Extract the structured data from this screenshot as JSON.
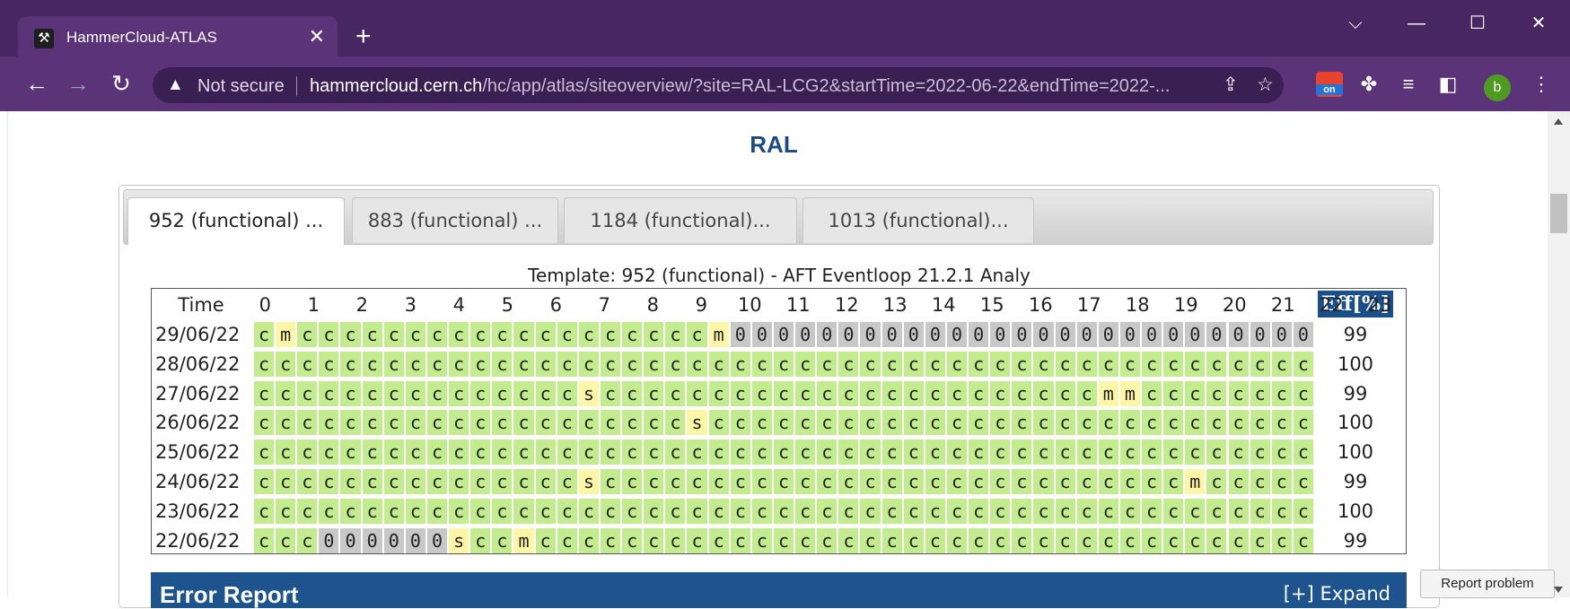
{
  "browser": {
    "tab_title": "HammerCloud-ATLAS",
    "tab_icon": "hammer-icon",
    "not_secure": "Not secure",
    "url_host": "hammercloud.cern.ch",
    "url_path": "/hc/app/atlas/siteoverview/?site=RAL-LCG2&startTime=2022-06-22&endTime=2022-...",
    "profile_initial": "b",
    "extension_badge": "on",
    "colors": {
      "frame": "#472662",
      "toolbar": "#5b3378",
      "omnibox": "#3a1f52",
      "avatar": "#4f9b22"
    }
  },
  "page": {
    "site_title": "RAL",
    "tabs": [
      {
        "label": "952 (functional) ...",
        "active": true
      },
      {
        "label": "883 (functional) ...",
        "active": false
      },
      {
        "label": "1184 (functional)...",
        "active": false
      },
      {
        "label": "1013 (functional)...",
        "active": false
      }
    ],
    "template_title": "Template: 952 (functional) - AFT Eventloop 21.2.1 Analy",
    "grid": {
      "time_label": "Time",
      "eff_label": "Eff[%]",
      "hours": [
        "0",
        "1",
        "2",
        "3",
        "4",
        "5",
        "6",
        "7",
        "8",
        "9",
        "10",
        "11",
        "12",
        "13",
        "14",
        "15",
        "16",
        "17",
        "18",
        "19",
        "20",
        "21",
        "22",
        "23"
      ],
      "legend_colors": {
        "c": "#c2ec8e",
        "m": "#fdf6a6",
        "s": "#fdf6a6",
        "0": "#c8c8c8"
      },
      "rows": [
        {
          "date": "29/06/22",
          "cells": "cmcccccccccccccccccccm000000000000000000000000000",
          "eff": "99"
        },
        {
          "date": "28/06/22",
          "cells": "ccccccccccccccccccccccccccccccccccccccccccccccccc",
          "eff": "100"
        },
        {
          "date": "27/06/22",
          "cells": "cccccccccccccccscccccccccccccccccccccccmmcccccccc",
          "eff": "99"
        },
        {
          "date": "26/06/22",
          "cells": "ccccccccccccccccccccscccccccccccccccccccccccccccc",
          "eff": "100"
        },
        {
          "date": "25/06/22",
          "cells": "ccccccccccccccccccccccccccccccccccccccccccccccccc",
          "eff": "100"
        },
        {
          "date": "24/06/22",
          "cells": "cccccccccccccccscccccccccccccccccccccccccccmccccc",
          "eff": "99"
        },
        {
          "date": "23/06/22",
          "cells": "ccccccccccccccccccccccccccccccccccccccccccccccccc",
          "eff": "100"
        },
        {
          "date": "22/06/22",
          "cells": "ccc000000sccmcccccccccccccccccccccccccccccccccccc",
          "eff": "99"
        }
      ]
    },
    "error_report": {
      "title": "Error Report",
      "expand_label": "[+] Expand"
    },
    "report_problem": "Report problem"
  }
}
